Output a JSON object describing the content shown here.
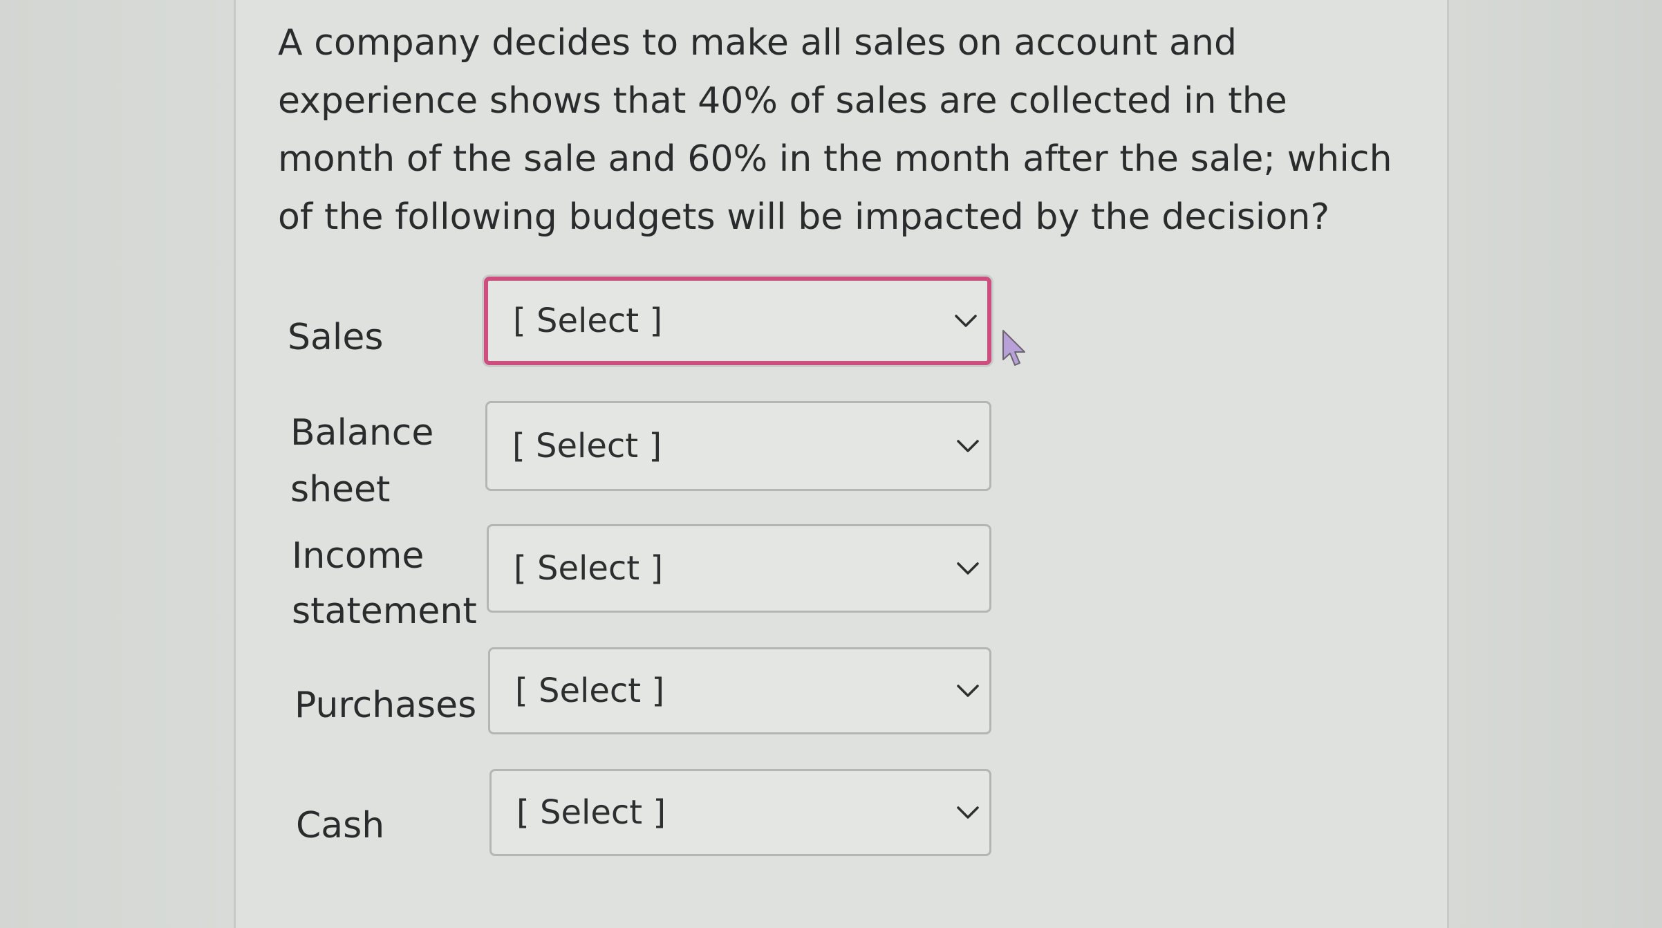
{
  "question": {
    "text": "A company decides to make all sales on account and experience shows that 40% of sales are collected in the month of the sale and 60% in the month after the sale; which of the following budgets will be impacted by the decision?"
  },
  "rows": [
    {
      "label": "Sales",
      "selected": "[ Select ]",
      "active": true
    },
    {
      "label_line1": "Balance",
      "label_line2": "sheet",
      "selected": "[ Select ]",
      "active": false
    },
    {
      "label_line1": "Income",
      "label_line2": "statement",
      "selected": "[ Select ]",
      "active": false
    },
    {
      "label": "Purchases",
      "selected": "[ Select ]",
      "active": false
    },
    {
      "label": "Cash",
      "selected": "[ Select ]",
      "active": false
    }
  ],
  "icons": {
    "dropdown": "chevron-down-icon",
    "pointer": "mouse-cursor-icon"
  },
  "colors": {
    "focus_border": "#cc4f80",
    "text": "#2a2b2d",
    "cursor_fill": "#b8a0d8"
  }
}
